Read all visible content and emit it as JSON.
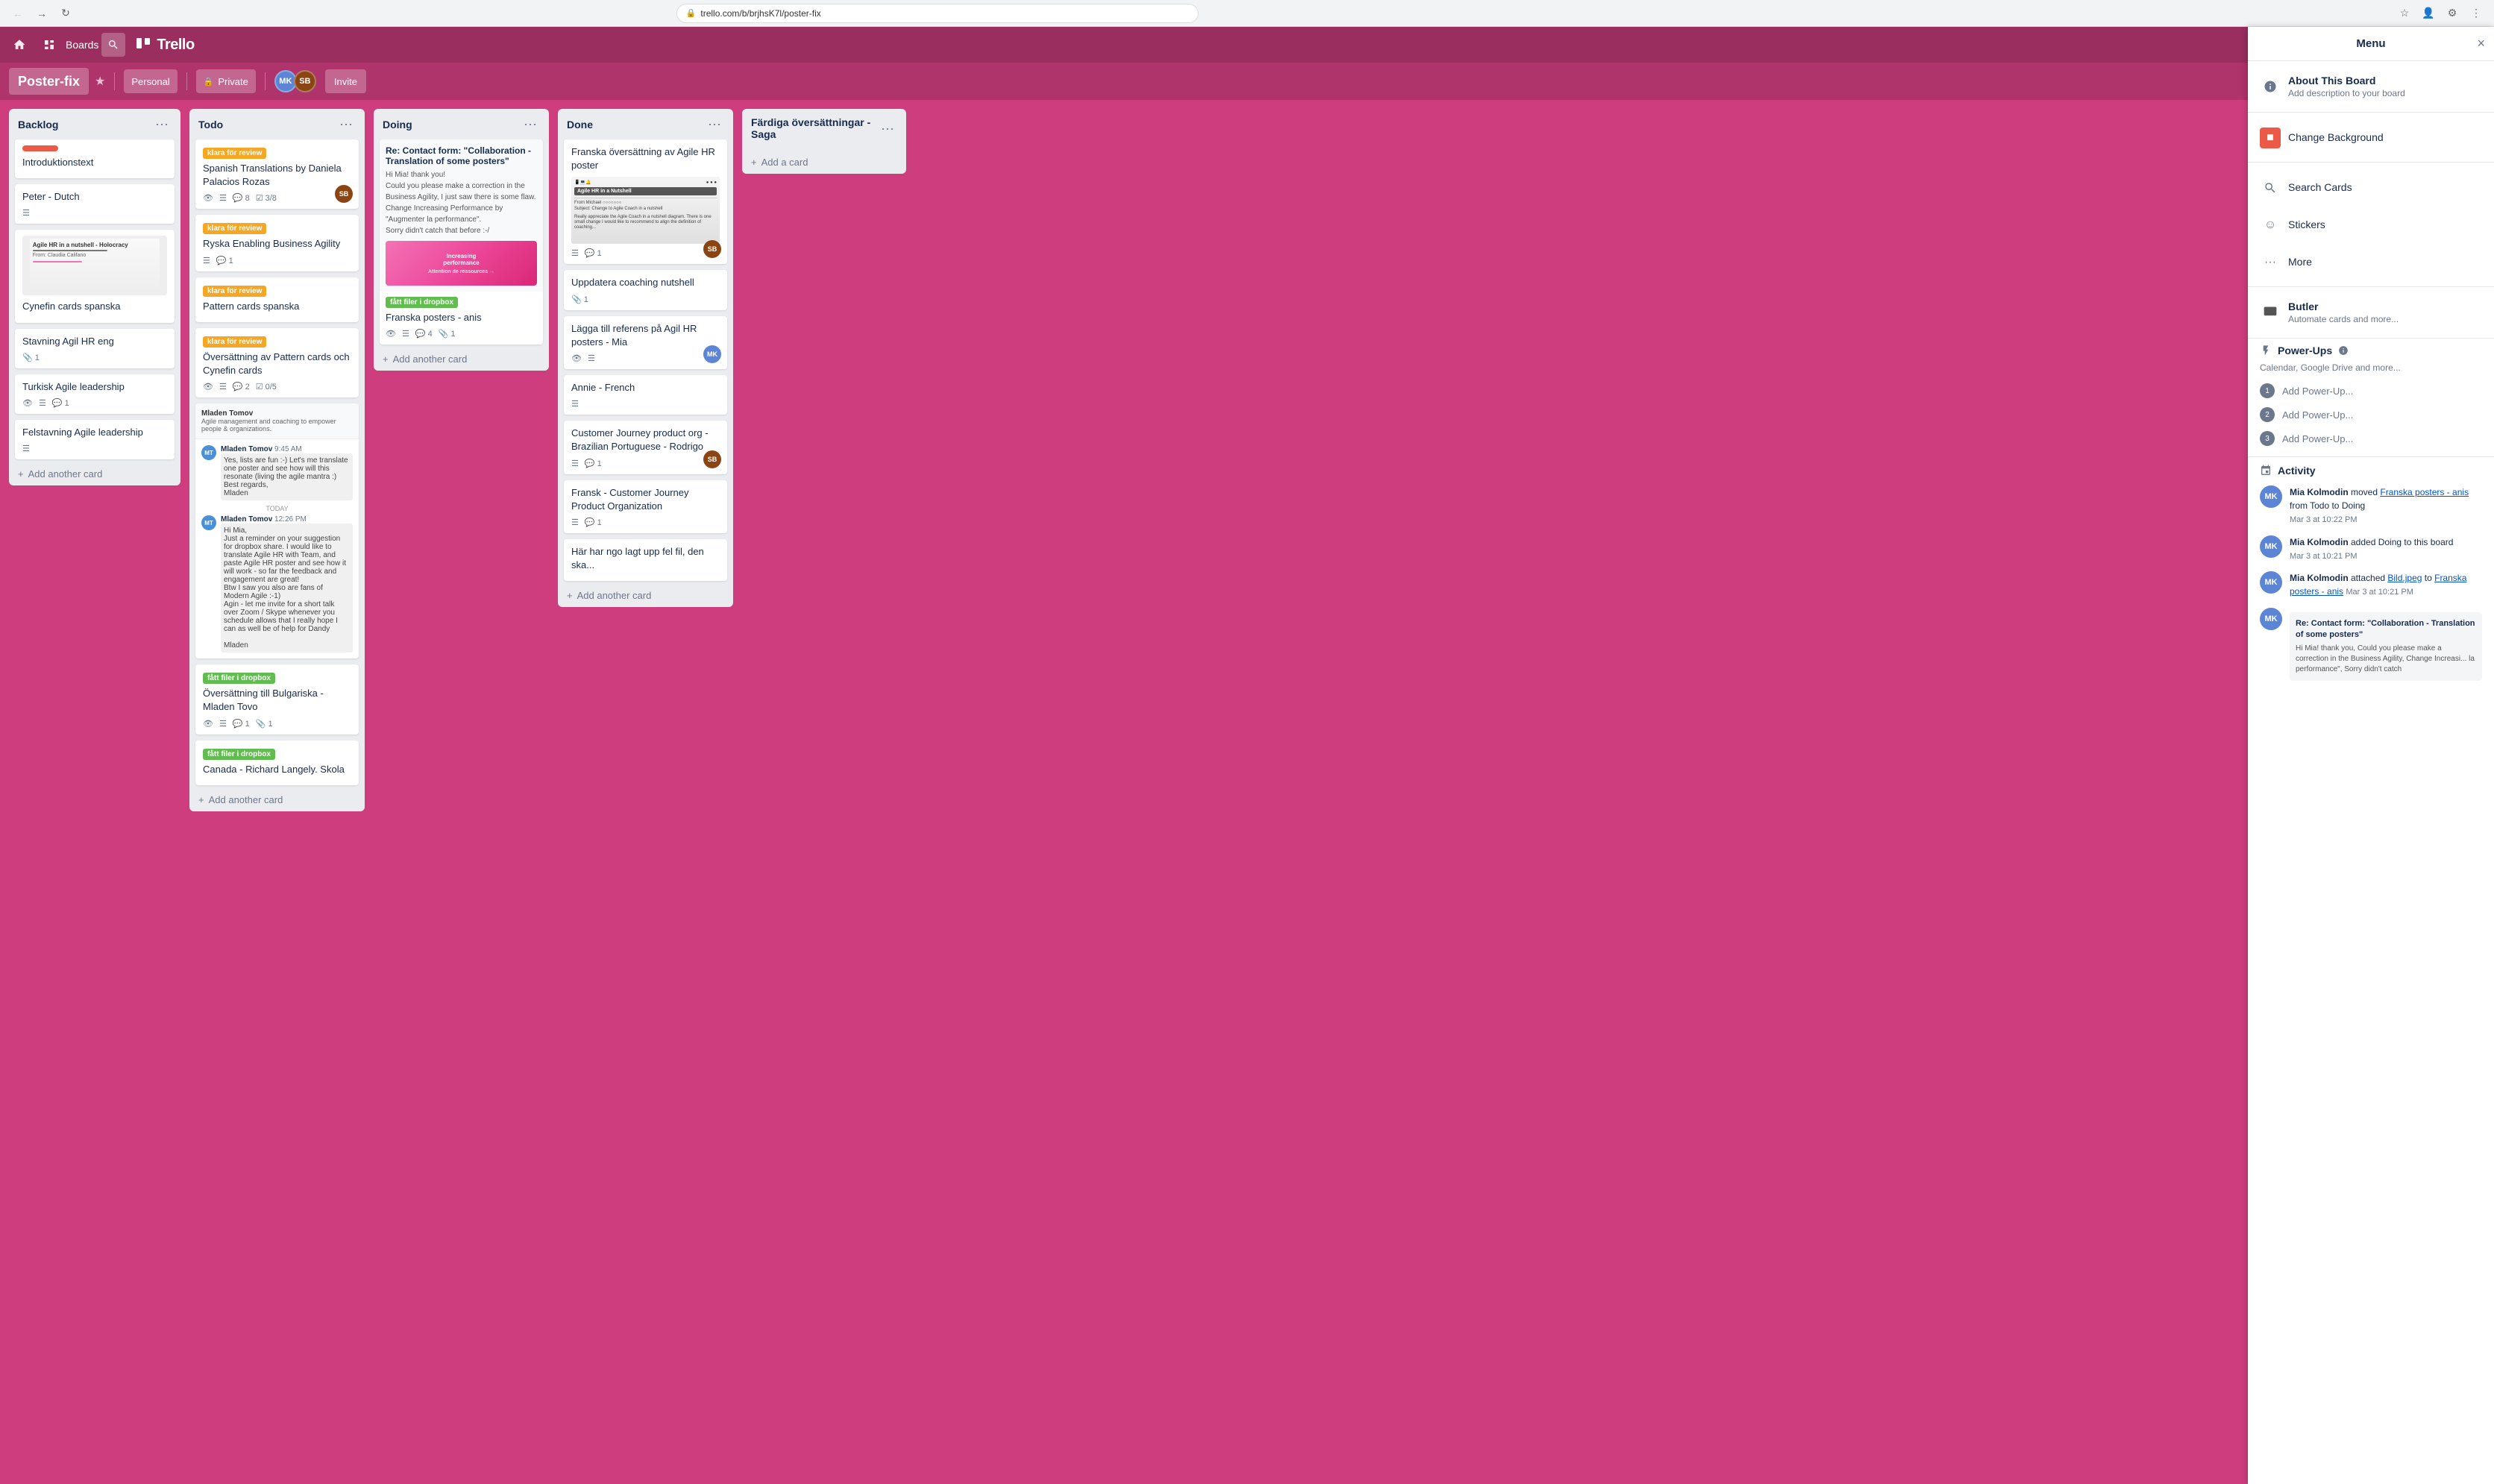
{
  "browser": {
    "url": "trello.com/b/brjhsK7l/poster-fix",
    "back_disabled": false,
    "forward_disabled": true
  },
  "header": {
    "boards_label": "Boards",
    "trello_logo": "Trello"
  },
  "board": {
    "title": "Poster-fix",
    "team": "Personal",
    "visibility": "Private",
    "invite_label": "Invite",
    "butler_label": "Butler",
    "members": [
      "MK",
      "SB"
    ]
  },
  "menu": {
    "title": "Menu",
    "close_icon": "×",
    "about": {
      "title": "About This Board",
      "desc": "Add description to your board"
    },
    "change_background": {
      "label": "Change Background"
    },
    "search_cards": {
      "label": "Search Cards"
    },
    "stickers": {
      "label": "Stickers"
    },
    "more": {
      "label": "More"
    },
    "butler": {
      "title": "Butler",
      "desc": "Automate cards and more..."
    },
    "powerups": {
      "title": "Power-Ups",
      "desc": "Calendar, Google Drive and more...",
      "items": [
        "Add Power-Up...",
        "Add Power-Up...",
        "Add Power-Up..."
      ]
    },
    "activity": {
      "title": "Activity",
      "items": [
        {
          "user": "Mia Kolmodin",
          "action": "moved",
          "link1": "Franska posters - anis",
          "middle": "from Todo to Doing",
          "time": "Mar 3 at 10:22 PM"
        },
        {
          "user": "Mia Kolmodin",
          "action": "added Doing to this board",
          "time": "Mar 3 at 10:21 PM"
        },
        {
          "user": "Mia Kolmodin",
          "action": "attached",
          "link1": "Bild.jpeg",
          "middle": "to",
          "link2": "Franska posters - anis",
          "time": "Mar 3 at 10:21 PM"
        },
        {
          "user": "Mia Kolmodin",
          "preview_title": "Re: Contact form: \"Collaboration - Translation of some posters\"",
          "preview_text": "Hi Mia! thank you, Could you please make a correction in the Business Agility, Change Increasi... la performance\", Sorry didn't catch"
        }
      ]
    }
  },
  "lists": [
    {
      "id": "backlog",
      "title": "Backlog",
      "cards": [
        {
          "id": "c1",
          "label": "red",
          "title": "Introduktionstext"
        },
        {
          "id": "c2",
          "title": "Peter - Dutch",
          "has_line": true
        },
        {
          "id": "c3",
          "title": "Cynefin cards spanska",
          "has_preview": true
        },
        {
          "id": "c4",
          "title": "Stavning Agil HR eng",
          "attach": "1"
        },
        {
          "id": "c5",
          "title": "Turkisk Agile leadership",
          "eye": true,
          "lines": true,
          "comments": "1"
        },
        {
          "id": "c6",
          "title": "Felstavning Agile leadership",
          "lines": true
        }
      ],
      "add_label": "+ Add another card"
    },
    {
      "id": "todo",
      "title": "Todo",
      "cards": [
        {
          "id": "t1",
          "badge": "klara för review",
          "badge_color": "orange",
          "title": "Spanish Translations by Daniela Palacios Rozas",
          "eye": true,
          "lines": true,
          "comments": "8",
          "checklist": "3/8",
          "avatar": "SB"
        },
        {
          "id": "t2",
          "badge": "klara för review",
          "badge_color": "orange",
          "title": "Ryska Enabling Business Agility",
          "lines": true,
          "comments": "1"
        },
        {
          "id": "t3",
          "badge": "klara för review",
          "badge_color": "orange",
          "title": "Pattern cards spanska"
        },
        {
          "id": "t4",
          "badge": "klara för review",
          "badge_color": "orange",
          "title": "Översättning av Pattern cards och Cynefin cards",
          "eye": true,
          "lines": true,
          "comments": "2",
          "checklist": "0/5"
        },
        {
          "id": "t5",
          "has_chat": true,
          "sender": "Mladen Tomov",
          "chat_title": "Mladen Tomov",
          "chat_time": "9:45 AM",
          "chat_msgs": [
            "Yes, lists are fun :-) Let's me translate one poster and see how will this resonate (living the agile mantra :)",
            "Best regards,",
            "Mladen"
          ]
        },
        {
          "id": "t6",
          "badge": "fått filer i dropbox",
          "badge_color": "green",
          "title": "Översättning till Bulgariska - Mladen Tovo",
          "eye": true,
          "lines": true,
          "comments": "1",
          "attach": "1"
        },
        {
          "id": "t7",
          "badge": "fått filer i dropbox",
          "badge_color": "green",
          "title": "Canada - Richard Langely. Skola"
        }
      ],
      "add_label": "+ Add another card"
    },
    {
      "id": "doing",
      "title": "Doing",
      "cards": [
        {
          "id": "d1",
          "title": "Re: Contact form: \"Collaboration - Translation of some posters\"",
          "has_email": true,
          "email_text": "Hi Mia! thank you!\nCould you please make a correction in the Business Agility, I just saw there is some flaw.\nChange Increasing Performance by \"Augmenter la performance\".\nSorry didn't catch that before :-/",
          "badge": "fått filer i dropbox",
          "badge_color": "green",
          "card2_title": "Franska posters - anis",
          "eye": true,
          "lines": true,
          "comments": "4",
          "attach": "1"
        }
      ],
      "add_label": "+ Add another card"
    },
    {
      "id": "done",
      "title": "Done",
      "cards": [
        {
          "id": "dn1",
          "title": "Franska översättning av Agile HR poster",
          "lines": true,
          "comments": "1",
          "avatar": "SB",
          "has_image": true
        },
        {
          "id": "dn2",
          "title": "Uppdatera coaching nutshell",
          "attach": "1"
        },
        {
          "id": "dn3",
          "title": "Lägga till referens på Agil HR posters - Mia",
          "eye": true,
          "lines": true,
          "avatar": "MK"
        },
        {
          "id": "dn4",
          "title": "Annie - French",
          "lines": true
        },
        {
          "id": "dn5",
          "title": "Customer Journey product org - Brazilian Portuguese - Rodrigo",
          "lines": true,
          "comments": "1",
          "avatar": "SB"
        },
        {
          "id": "dn6",
          "title": "Fransk - Customer Journey Product Organization",
          "lines": true,
          "comments": "1"
        },
        {
          "id": "dn7",
          "title": "Här har ngo lagt upp fel fil, den ska..."
        }
      ],
      "add_label": "+ Add another card"
    },
    {
      "id": "fagliga",
      "title": "Färdiga översättningar - Saga",
      "cards": [],
      "add_label": "+ Add a card"
    }
  ]
}
